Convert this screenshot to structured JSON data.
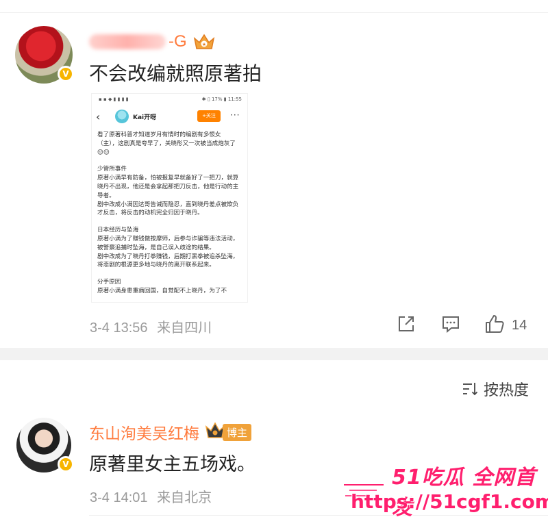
{
  "comment1": {
    "username_visible": "-G",
    "text": "不会改编就照原著拍",
    "timestamp": "3-4 13:56",
    "location": "来自四川",
    "likes": "14",
    "embedded_screenshot": {
      "status_left": "▪ ▪ ◆ ▮ ▮ ▮ ▮",
      "status_right": "✱ ▯ 17% ▮ 11:55",
      "back": "‹",
      "account_name": "Kai开呀",
      "follow_label": "+关注",
      "more": "···",
      "paragraphs": [
        "看了原著科普才知道岁月有情时的编剧有多恨女（主），这剧真是夸早了，关晓彤又一次被当成炮灰了😔😔",
        "",
        "少管所事件",
        "原著小满早有防备，怕被报复早就备好了一把刀，就算晓丹不出现，他还是会拿起那把刀反击，他是行动的主导者。",
        "剧中改成小满因达哥告诫而隐忍，直到晓丹差点被欺负才反击，将反击的动机完全归因于晓丹。",
        "",
        "日本经历与坠海",
        "原著小满为了赚钱做按摩师，后参与诈骗等违法活动，被警察追捕时坠海，是自己误入歧途的结果。",
        "剧中改成为了晓丹打拳赚钱，后期打黑拳被追杀坠海，将悲剧的根源更多地与晓丹的离开联系起来。",
        "",
        "分手原因",
        "原著小满身患重病回国，自觉配不上晓丹，为了不"
      ]
    }
  },
  "sort": {
    "label": "按热度"
  },
  "comment2": {
    "username": "东山洵美吴红梅",
    "badge": "博主",
    "text": "原著里女主五场戏。",
    "timestamp": "3-4 14:01",
    "location": "来自北京"
  },
  "watermark": {
    "title": "51吃瓜 全网首发",
    "url": "https://51cgf1.com"
  },
  "colors": {
    "username": "#ff7a3c",
    "verified": "#f7b500",
    "watermark": "#ff1f6e",
    "follow_button": "#ff8200"
  }
}
